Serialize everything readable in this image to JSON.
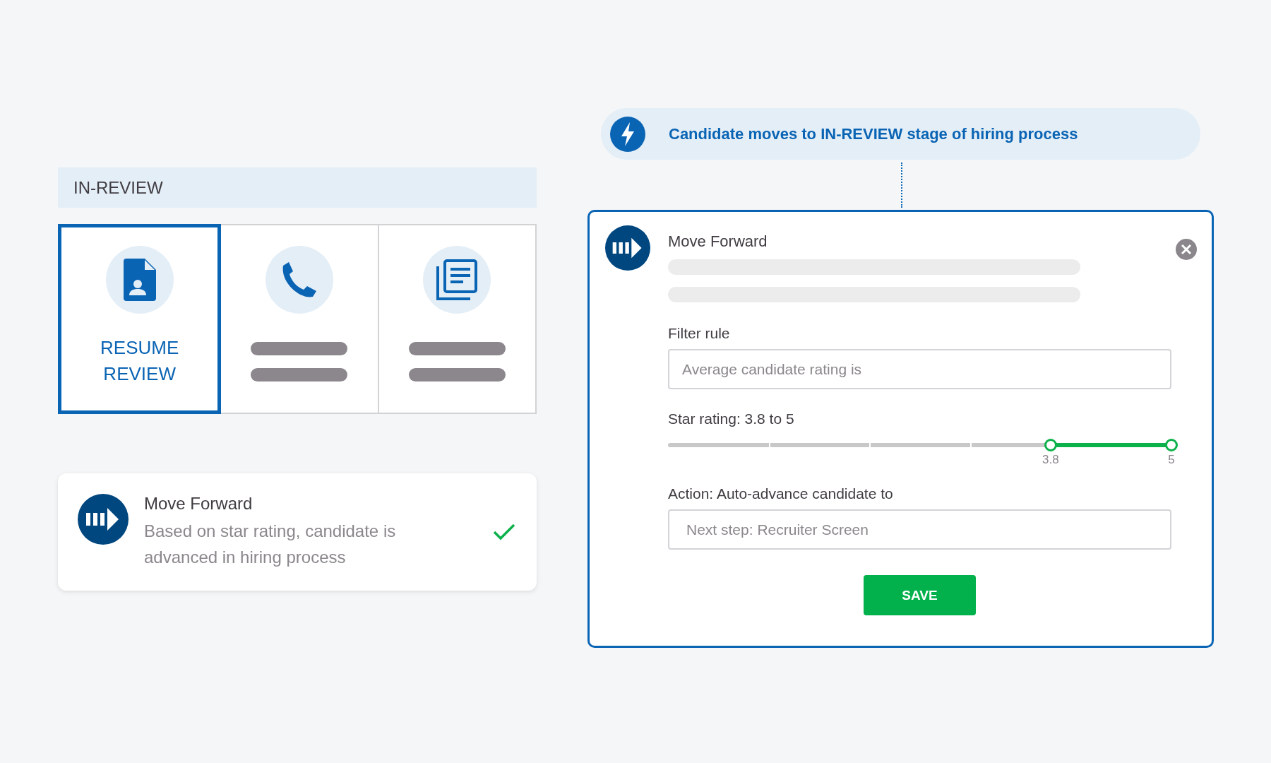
{
  "stage_header": {
    "title": "IN-REVIEW"
  },
  "stage_cards": [
    {
      "label": "RESUME REVIEW",
      "selected": true
    },
    {
      "selected": false
    },
    {
      "selected": false
    }
  ],
  "result_card": {
    "title": "Move Forward",
    "description": "Based on star rating, candidate is advanced in hiring process",
    "done": true
  },
  "trigger": {
    "text": "Candidate moves to IN-REVIEW stage of hiring process"
  },
  "action_panel": {
    "title": "Move Forward",
    "filter_label": "Filter rule",
    "filter_field": {
      "placeholder": "Average candidate rating is"
    },
    "rating_label": "Star rating: 3.8 to 5",
    "rating_thumbs": [
      {
        "level": 0.76,
        "label": "3.8"
      },
      {
        "level": 1,
        "label": "5"
      }
    ],
    "action_label": "Action: Auto-advance candidate to",
    "action_field": {
      "placeholder": "Next step: Recruiter Screen"
    },
    "save_button": "SAVE"
  }
}
